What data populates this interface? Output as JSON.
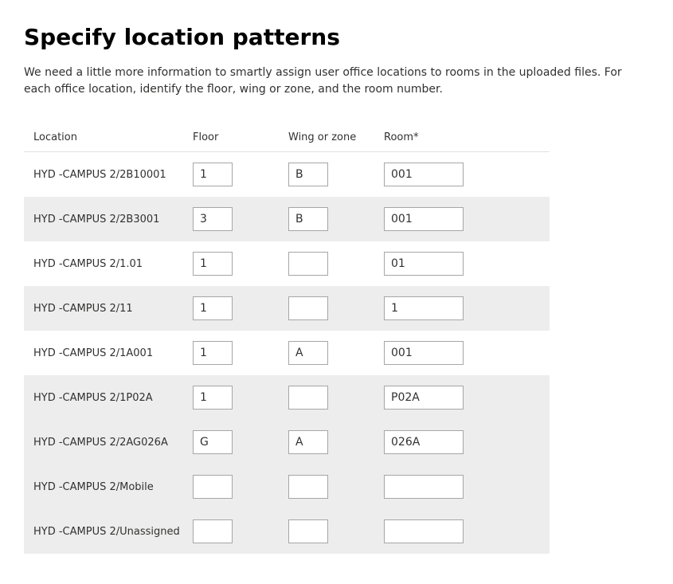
{
  "title": "Specify location patterns",
  "description": "We need a little more information to smartly assign user office locations to rooms in the uploaded files. For each office location, identify the floor, wing or zone, and the room number.",
  "headers": {
    "location": "Location",
    "floor": "Floor",
    "wing": "Wing or zone",
    "room": "Room*"
  },
  "rows": [
    {
      "location": "HYD -CAMPUS 2/2B10001",
      "floor": "1",
      "wing": "B",
      "room": "001",
      "highlight": false
    },
    {
      "location": "HYD -CAMPUS 2/2B3001",
      "floor": "3",
      "wing": "B",
      "room": "001",
      "highlight": false
    },
    {
      "location": "HYD -CAMPUS 2/1.01",
      "floor": "1",
      "wing": "",
      "room": "01",
      "highlight": false
    },
    {
      "location": "HYD -CAMPUS 2/11",
      "floor": "1",
      "wing": "",
      "room": "1",
      "highlight": false
    },
    {
      "location": "HYD -CAMPUS 2/1A001",
      "floor": "1",
      "wing": "A",
      "room": "001",
      "highlight": false
    },
    {
      "location": "HYD -CAMPUS 2/1P02A",
      "floor": "1",
      "wing": "",
      "room": "P02A",
      "highlight": false
    },
    {
      "location": "HYD -CAMPUS 2/2AG026A",
      "floor": "G",
      "wing": "A",
      "room": "026A",
      "highlight": true
    },
    {
      "location": "HYD -CAMPUS 2/Mobile",
      "floor": "",
      "wing": "",
      "room": "",
      "highlight": false
    },
    {
      "location": "HYD -CAMPUS 2/Unassigned",
      "floor": "",
      "wing": "",
      "room": "",
      "highlight": true
    }
  ]
}
